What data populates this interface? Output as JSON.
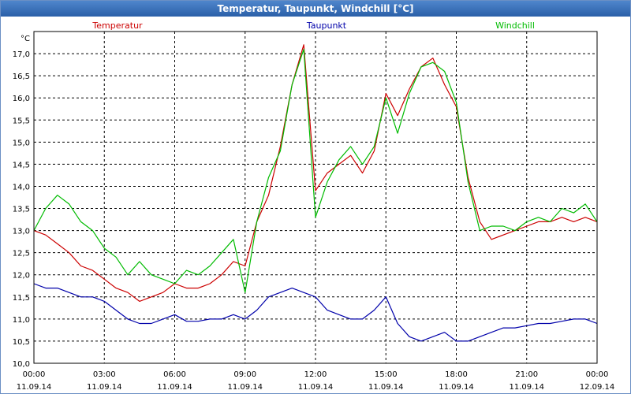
{
  "window": {
    "title": "Temperatur, Taupunkt, Windchill [°C]"
  },
  "chart_data": {
    "type": "line",
    "title": "Temperatur, Taupunkt, Windchill [°C]",
    "yunit": "°C",
    "ylim": [
      10.0,
      17.5
    ],
    "yticks": [
      "10,0",
      "10,5",
      "11,0",
      "11,5",
      "12,0",
      "12,5",
      "13,0",
      "13,5",
      "14,0",
      "14,5",
      "15,0",
      "15,5",
      "16,0",
      "16,5",
      "17,0"
    ],
    "xlim_hours": [
      0,
      24
    ],
    "xticks": [
      {
        "time": "00:00",
        "date": "11.09.14"
      },
      {
        "time": "03:00",
        "date": "11.09.14"
      },
      {
        "time": "06:00",
        "date": "11.09.14"
      },
      {
        "time": "09:00",
        "date": "11.09.14"
      },
      {
        "time": "12:00",
        "date": "11.09.14"
      },
      {
        "time": "15:00",
        "date": "11.09.14"
      },
      {
        "time": "18:00",
        "date": "11.09.14"
      },
      {
        "time": "21:00",
        "date": "11.09.14"
      },
      {
        "time": "00:00",
        "date": "12.09.14"
      }
    ],
    "grid": true,
    "legend_position": "top",
    "series": [
      {
        "name": "Temperatur",
        "color": "#cc0000",
        "x": [
          0,
          0.5,
          1,
          1.5,
          2,
          2.5,
          3,
          3.5,
          4,
          4.5,
          5,
          5.5,
          6,
          6.5,
          7,
          7.5,
          8,
          8.5,
          9,
          9.5,
          10,
          10.5,
          11,
          11.5,
          12,
          12.5,
          13,
          13.5,
          14,
          14.5,
          15,
          15.5,
          16,
          16.5,
          17,
          17.5,
          18,
          18.5,
          19,
          19.5,
          20,
          20.5,
          21,
          21.5,
          22,
          22.5,
          23,
          23.5,
          24
        ],
        "values": [
          13.0,
          12.9,
          12.7,
          12.5,
          12.2,
          12.1,
          11.9,
          11.7,
          11.6,
          11.4,
          11.5,
          11.6,
          11.8,
          11.7,
          11.7,
          11.8,
          12.0,
          12.3,
          12.2,
          13.2,
          13.8,
          14.9,
          16.3,
          17.2,
          13.9,
          14.3,
          14.5,
          14.7,
          14.3,
          14.8,
          16.1,
          15.6,
          16.2,
          16.7,
          16.9,
          16.3,
          15.8,
          14.2,
          13.2,
          12.8,
          12.9,
          13.0,
          13.1,
          13.2,
          13.2,
          13.3,
          13.2,
          13.3,
          13.2
        ]
      },
      {
        "name": "Taupunkt",
        "color": "#0000aa",
        "x": [
          0,
          0.5,
          1,
          1.5,
          2,
          2.5,
          3,
          3.5,
          4,
          4.5,
          5,
          5.5,
          6,
          6.5,
          7,
          7.5,
          8,
          8.5,
          9,
          9.5,
          10,
          10.5,
          11,
          11.5,
          12,
          12.5,
          13,
          13.5,
          14,
          14.5,
          15,
          15.5,
          16,
          16.5,
          17,
          17.5,
          18,
          18.5,
          19,
          19.5,
          20,
          20.5,
          21,
          21.5,
          22,
          22.5,
          23,
          23.5,
          24
        ],
        "values": [
          11.8,
          11.7,
          11.7,
          11.6,
          11.5,
          11.5,
          11.4,
          11.2,
          11.0,
          10.9,
          10.9,
          11.0,
          11.1,
          10.95,
          10.95,
          11.0,
          11.0,
          11.1,
          11.0,
          11.2,
          11.5,
          11.6,
          11.7,
          11.6,
          11.5,
          11.2,
          11.1,
          11.0,
          11.0,
          11.2,
          11.5,
          10.9,
          10.6,
          10.5,
          10.6,
          10.7,
          10.5,
          10.5,
          10.6,
          10.7,
          10.8,
          10.8,
          10.85,
          10.9,
          10.9,
          10.95,
          11.0,
          11.0,
          10.9
        ]
      },
      {
        "name": "Windchill",
        "color": "#00bb00",
        "x": [
          0,
          0.5,
          1,
          1.5,
          2,
          2.5,
          3,
          3.5,
          4,
          4.5,
          5,
          5.5,
          6,
          6.5,
          7,
          7.5,
          8,
          8.5,
          9,
          9.5,
          10,
          10.5,
          11,
          11.5,
          12,
          12.5,
          13,
          13.5,
          14,
          14.5,
          15,
          15.5,
          16,
          16.5,
          17,
          17.5,
          18,
          18.5,
          19,
          19.5,
          20,
          20.5,
          21,
          21.5,
          22,
          22.5,
          23,
          23.5,
          24
        ],
        "values": [
          13.0,
          13.5,
          13.8,
          13.6,
          13.2,
          13.0,
          12.6,
          12.4,
          12.0,
          12.3,
          12.0,
          11.9,
          11.8,
          12.1,
          12.0,
          12.2,
          12.5,
          12.8,
          11.6,
          13.2,
          14.2,
          14.8,
          16.3,
          17.1,
          13.3,
          14.1,
          14.6,
          14.9,
          14.5,
          14.9,
          16.0,
          15.2,
          16.1,
          16.7,
          16.8,
          16.6,
          15.9,
          14.1,
          13.0,
          13.1,
          13.1,
          13.0,
          13.2,
          13.3,
          13.2,
          13.5,
          13.4,
          13.6,
          13.2
        ]
      }
    ]
  }
}
